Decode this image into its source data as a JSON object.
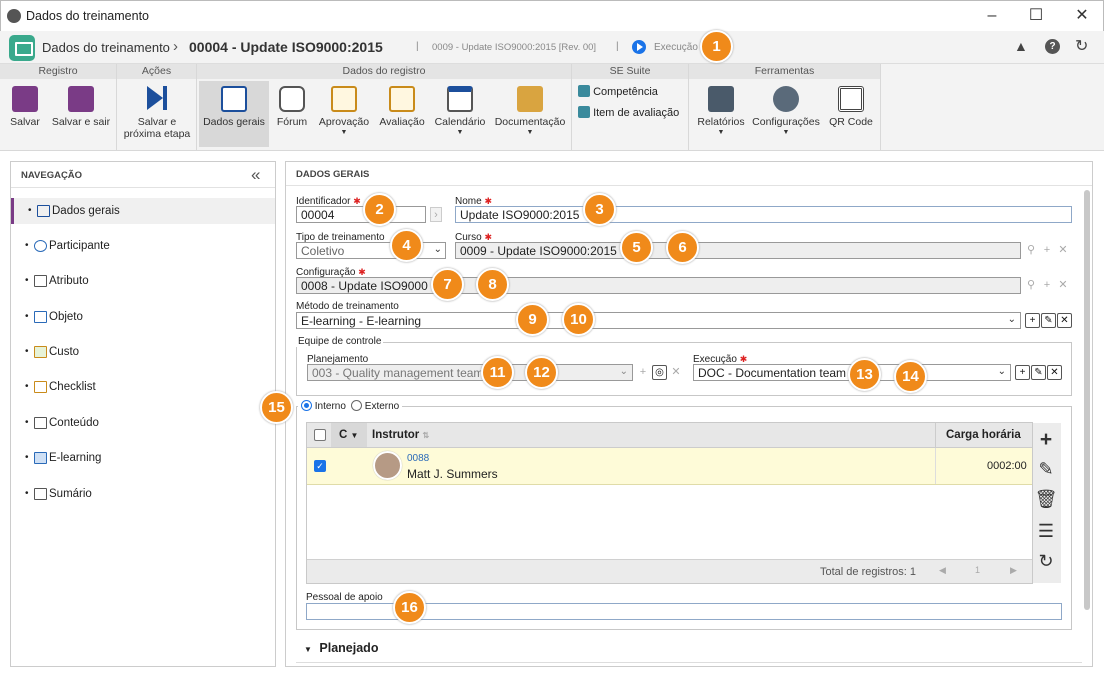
{
  "window": {
    "title": "Dados do treinamento"
  },
  "header": {
    "breadcrumb_root": "Dados do treinamento",
    "breadcrumb_sep": "›",
    "record_title": "00004 - Update ISO9000:2015",
    "subtitle": "0009 - Update ISO9000:2015 [Rev. 00]",
    "separator": "|",
    "status": "Execução",
    "status_color": "#1a73e8"
  },
  "ribbon": {
    "groups": {
      "registro": "Registro",
      "acoes": "Ações",
      "dados": "Dados do registro",
      "suite": "SE Suite",
      "ferramentas": "Ferramentas"
    },
    "buttons": {
      "salvar": "Salvar",
      "salvar_sair": "Salvar e sair",
      "salvar_proxima_1": "Salvar e",
      "salvar_proxima_2": "próxima etapa",
      "dados_gerais": "Dados gerais",
      "forum": "Fórum",
      "aprovacao": "Aprovação",
      "avaliacao": "Avaliação",
      "calendario": "Calendário",
      "documentacao": "Documentação",
      "competencia": "Competência",
      "item_avaliacao": "Item de avaliação",
      "relatorios": "Relatórios",
      "configuracoes": "Configurações",
      "qr_code": "QR Code"
    }
  },
  "nav": {
    "title": "NAVEGAÇÃO",
    "collapse": "«",
    "items": [
      {
        "label": "Dados gerais"
      },
      {
        "label": "Participante"
      },
      {
        "label": "Atributo"
      },
      {
        "label": "Objeto"
      },
      {
        "label": "Custo"
      },
      {
        "label": "Checklist"
      },
      {
        "label": "Conteúdo"
      },
      {
        "label": "E-learning"
      },
      {
        "label": "Sumário"
      }
    ]
  },
  "form": {
    "section_title": "DADOS GERAIS",
    "identificador": {
      "label": "Identificador",
      "value": "00004"
    },
    "nome": {
      "label": "Nome",
      "value": "Update ISO9000:2015"
    },
    "tipo": {
      "label": "Tipo de treinamento",
      "value": "Coletivo"
    },
    "curso": {
      "label": "Curso",
      "value": "0009 - Update ISO9000:2015"
    },
    "configuracao": {
      "label": "Configuração",
      "value": "0008 - Update ISO9000"
    },
    "metodo": {
      "label": "Método de treinamento",
      "value": "E-learning - E-learning"
    },
    "equipe": {
      "legend": "Equipe de controle",
      "planejamento": {
        "label": "Planejamento",
        "value": "003 - Quality management team"
      },
      "execucao": {
        "label": "Execução",
        "value": "DOC - Documentation team"
      }
    },
    "tipo_instrutor": {
      "interno": "Interno",
      "externo": "Externo",
      "selected": "Interno"
    },
    "grid": {
      "columns": {
        "c": "C",
        "instrutor": "Instrutor",
        "carga": "Carga horária"
      },
      "rows": [
        {
          "id": "0088",
          "name": "Matt J. Summers",
          "carga": "0002:00",
          "checked": true
        }
      ],
      "total_label": "Total de registros: 1"
    },
    "pessoal": {
      "label": "Pessoal de apoio",
      "value": ""
    },
    "planejado": "Planejado"
  },
  "badges": [
    "1",
    "2",
    "3",
    "4",
    "5",
    "6",
    "7",
    "8",
    "9",
    "10",
    "11",
    "12",
    "13",
    "14",
    "15",
    "16"
  ]
}
